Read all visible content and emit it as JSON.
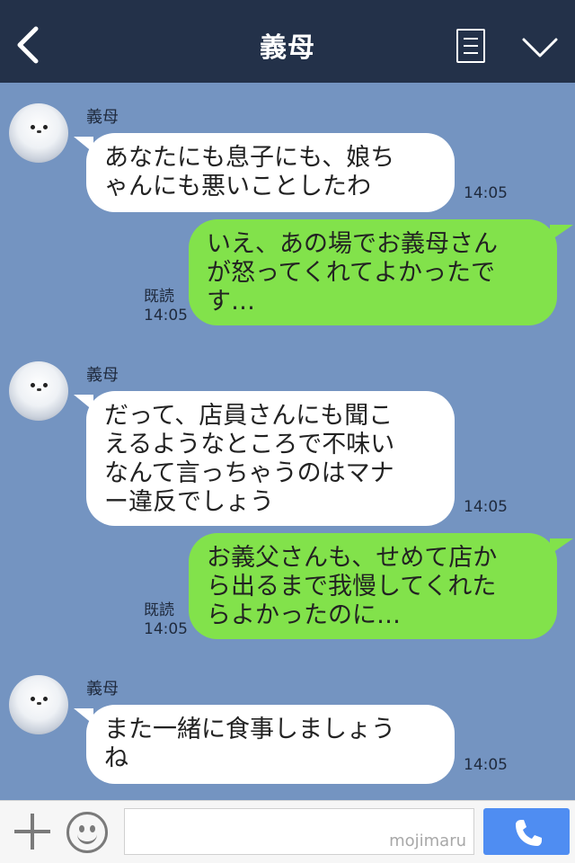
{
  "header": {
    "title": "義母",
    "back_icon": "chevron-left-icon",
    "menu_icon": "menu-icon",
    "more_icon": "chevron-down-icon"
  },
  "messages": [
    {
      "sender": "義母",
      "lines": [
        "あなたにも息子にも、娘ち",
        "ゃんにも悪いことしたわ"
      ],
      "time": "14:05"
    },
    {
      "lines": [
        "いえ、あの場でお義母さん",
        "が怒ってくれてよかったで",
        "す…"
      ],
      "read": "既読",
      "time": "14:05"
    },
    {
      "sender": "義母",
      "lines": [
        "だって、店員さんにも聞こ",
        "えるようなところで不味い",
        "なんて言っちゃうのはマナ",
        "ー違反でしょう"
      ],
      "time": "14:05"
    },
    {
      "lines": [
        "お義父さんも、せめて店か",
        "ら出るまで我慢してくれた",
        "らよかったのに…"
      ],
      "read": "既読",
      "time": "14:05"
    },
    {
      "sender": "義母",
      "lines": [
        "また一緒に食事しましょう",
        "ね"
      ],
      "time": "14:05"
    }
  ],
  "footer": {
    "watermark": "mojimaru",
    "plus_icon": "plus-icon",
    "emoji_icon": "smiley-icon",
    "call_icon": "phone-icon"
  },
  "colors": {
    "header_bg": "#233149",
    "chat_bg": "#7494c1",
    "outgoing_bubble": "#82e24b",
    "incoming_bubble": "#ffffff",
    "call_button": "#4f8df2"
  }
}
